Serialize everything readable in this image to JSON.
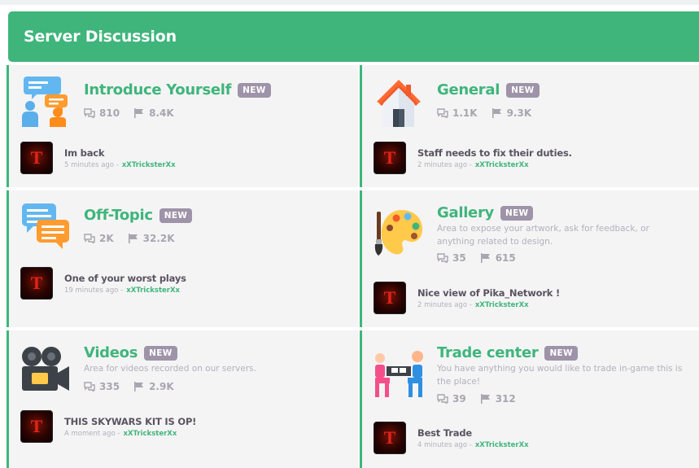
{
  "header": {
    "title": "Server Discussion"
  },
  "forums": [
    {
      "title": "Introduce Yourself",
      "badge": "NEW",
      "description": "",
      "threads": "810",
      "posts": "8.4K",
      "latest": {
        "title": "Im back",
        "time": "5 minutes ago",
        "separator": "-",
        "user": "xXTricksterXx",
        "avatar_letter": "T"
      }
    },
    {
      "title": "General",
      "badge": "NEW",
      "description": "",
      "threads": "1.1K",
      "posts": "9.3K",
      "latest": {
        "title": "Staff needs to fix their duties.",
        "time": "2 minutes ago",
        "separator": "-",
        "user": "xXTricksterXx",
        "avatar_letter": "T"
      }
    },
    {
      "title": "Off-Topic",
      "badge": "NEW",
      "description": "",
      "threads": "2K",
      "posts": "32.2K",
      "latest": {
        "title": "One of your worst plays",
        "time": "19 minutes ago",
        "separator": "-",
        "user": "xXTricksterXx",
        "avatar_letter": "T"
      }
    },
    {
      "title": "Gallery",
      "badge": "NEW",
      "description": "Area to expose your artwork, ask for feedback, or anything related to design.",
      "threads": "35",
      "posts": "615",
      "latest": {
        "title": "Nice view of Pika_Network !",
        "time": "2 minutes ago",
        "separator": "-",
        "user": "xXTricksterXx",
        "avatar_letter": "T"
      }
    },
    {
      "title": "Videos",
      "badge": "NEW",
      "description": "Area for videos recorded on our servers.",
      "threads": "335",
      "posts": "2.9K",
      "latest": {
        "title": "THIS SKYWARS KIT IS OP!",
        "time": "A moment ago",
        "separator": "-",
        "user": "xXTricksterXx",
        "avatar_letter": "T"
      }
    },
    {
      "title": "Trade center",
      "badge": "NEW",
      "description": "You have anything you would like to trade in-game this is the place!",
      "threads": "39",
      "posts": "312",
      "latest": {
        "title": "Best Trade",
        "time": "4 minutes ago",
        "separator": "-",
        "user": "xXTricksterXx",
        "avatar_letter": "T"
      }
    }
  ],
  "icons": {
    "forum0": "people-chat-icon",
    "forum1": "house-icon",
    "forum2": "chat-bubbles-icon",
    "forum3": "paint-palette-icon",
    "forum4": "video-camera-icon",
    "forum5": "trade-people-icon",
    "threads": "threads-icon",
    "posts": "posts-flag-icon"
  },
  "colors": {
    "accent": "#3fb57b",
    "badge": "#9e93a8",
    "card": "#f4f4f5"
  }
}
